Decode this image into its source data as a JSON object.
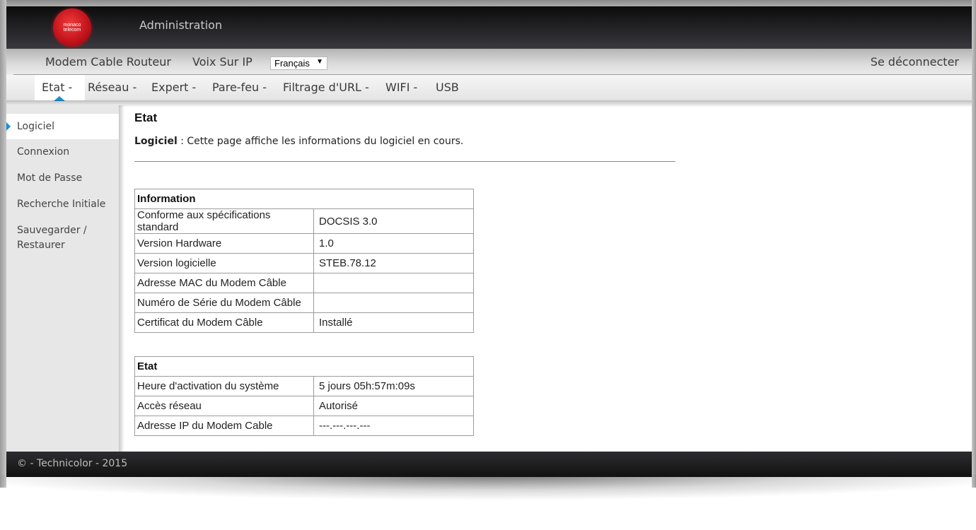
{
  "header": {
    "logo_line1": "monaco",
    "logo_line2": "telecom",
    "title": "Administration"
  },
  "topnav": {
    "items": [
      "Modem Cable Routeur",
      "Voix Sur IP"
    ],
    "language_selected": "Français",
    "logout_label": "Se déconnecter"
  },
  "subnav": {
    "items": [
      "Etat -",
      "Réseau -",
      "Expert -",
      "Pare-feu -",
      "Filtrage d'URL -",
      "WIFI -",
      "USB"
    ],
    "active_index": 0
  },
  "sidebar": {
    "items": [
      "Logiciel",
      "Connexion",
      "Mot de Passe",
      "Recherche Initiale",
      "Sauvegarder /",
      "Restaurer"
    ],
    "active_index": 0
  },
  "content": {
    "title": "Etat",
    "desc_label": "Logiciel",
    "desc_sep": " : ",
    "desc_text": "Cette page affiche les informations du logiciel en cours.",
    "info_table": {
      "header": "Information",
      "rows": [
        [
          "Conforme aux spécifications standard",
          "DOCSIS 3.0"
        ],
        [
          "Version Hardware",
          "1.0"
        ],
        [
          "Version logicielle",
          "STEB.78.12"
        ],
        [
          "Adresse MAC du Modem Câble",
          ""
        ],
        [
          "Numéro de Série du Modem Câble",
          ""
        ],
        [
          "Certificat du Modem Câble",
          "Installé"
        ]
      ]
    },
    "state_table": {
      "header": "Etat",
      "rows": [
        [
          "Heure d'activation du système",
          "5 jours 05h:57m:09s"
        ],
        [
          "Accès réseau",
          "Autorisé"
        ],
        [
          "Adresse IP du Modem Cable",
          "---.---.---.---"
        ]
      ]
    }
  },
  "footer": {
    "text": "© - Technicolor - 2015"
  },
  "colors": {
    "accent": "#1a8fd6",
    "header_dark": "#0c0c0c",
    "logo_red": "#c0111a"
  }
}
